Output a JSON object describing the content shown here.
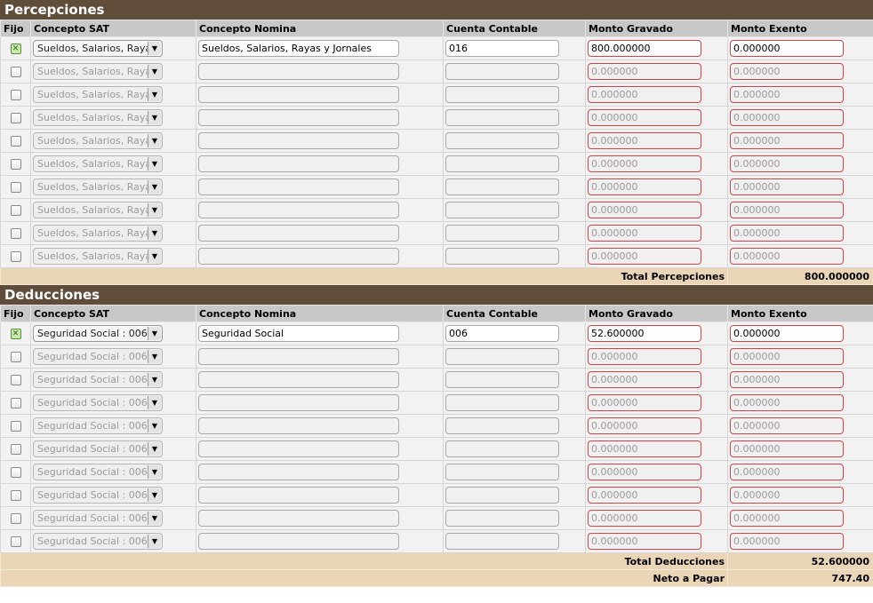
{
  "percepciones": {
    "title": "Percepciones",
    "headers": {
      "fijo": "Fijo",
      "concepto_sat": "Concepto SAT",
      "concepto_nomina": "Concepto Nomina",
      "cuenta_contable": "Cuenta Contable",
      "monto_gravado": "Monto Gravado",
      "monto_exento": "Monto Exento"
    },
    "rows": [
      {
        "fijo": true,
        "concepto_sat": "Sueldos, Salarios, Raya",
        "concepto_nomina": "Sueldos, Salarios, Rayas y Jornales",
        "cuenta": "016",
        "gravado": "800.000000",
        "exento": "0.000000",
        "enabled": true
      },
      {
        "fijo": false,
        "concepto_sat": "Sueldos, Salarios, Raya",
        "concepto_nomina": "",
        "cuenta": "",
        "gravado": "0.000000",
        "exento": "0.000000",
        "enabled": false
      },
      {
        "fijo": false,
        "concepto_sat": "Sueldos, Salarios, Raya",
        "concepto_nomina": "",
        "cuenta": "",
        "gravado": "0.000000",
        "exento": "0.000000",
        "enabled": false
      },
      {
        "fijo": false,
        "concepto_sat": "Sueldos, Salarios, Raya",
        "concepto_nomina": "",
        "cuenta": "",
        "gravado": "0.000000",
        "exento": "0.000000",
        "enabled": false
      },
      {
        "fijo": false,
        "concepto_sat": "Sueldos, Salarios, Raya",
        "concepto_nomina": "",
        "cuenta": "",
        "gravado": "0.000000",
        "exento": "0.000000",
        "enabled": false
      },
      {
        "fijo": false,
        "concepto_sat": "Sueldos, Salarios, Raya",
        "concepto_nomina": "",
        "cuenta": "",
        "gravado": "0.000000",
        "exento": "0.000000",
        "enabled": false
      },
      {
        "fijo": false,
        "concepto_sat": "Sueldos, Salarios, Raya",
        "concepto_nomina": "",
        "cuenta": "",
        "gravado": "0.000000",
        "exento": "0.000000",
        "enabled": false
      },
      {
        "fijo": false,
        "concepto_sat": "Sueldos, Salarios, Raya",
        "concepto_nomina": "",
        "cuenta": "",
        "gravado": "0.000000",
        "exento": "0.000000",
        "enabled": false
      },
      {
        "fijo": false,
        "concepto_sat": "Sueldos, Salarios, Raya",
        "concepto_nomina": "",
        "cuenta": "",
        "gravado": "0.000000",
        "exento": "0.000000",
        "enabled": false
      },
      {
        "fijo": false,
        "concepto_sat": "Sueldos, Salarios, Raya",
        "concepto_nomina": "",
        "cuenta": "",
        "gravado": "0.000000",
        "exento": "0.000000",
        "enabled": false
      }
    ],
    "total_label": "Total Percepciones",
    "total_value": "800.000000"
  },
  "deducciones": {
    "title": "Deducciones",
    "headers": {
      "fijo": "Fijo",
      "concepto_sat": "Concepto SAT",
      "concepto_nomina": "Concepto Nomina",
      "cuenta_contable": "Cuenta Contable",
      "monto_gravado": "Monto Gravado",
      "monto_exento": "Monto Exento"
    },
    "rows": [
      {
        "fijo": true,
        "concepto_sat": "Seguridad Social : 006",
        "concepto_nomina": "Seguridad Social",
        "cuenta": "006",
        "gravado": "52.600000",
        "exento": "0.000000",
        "enabled": true
      },
      {
        "fijo": false,
        "concepto_sat": "Seguridad Social : 006",
        "concepto_nomina": "",
        "cuenta": "",
        "gravado": "0.000000",
        "exento": "0.000000",
        "enabled": false
      },
      {
        "fijo": false,
        "concepto_sat": "Seguridad Social : 006",
        "concepto_nomina": "",
        "cuenta": "",
        "gravado": "0.000000",
        "exento": "0.000000",
        "enabled": false
      },
      {
        "fijo": false,
        "concepto_sat": "Seguridad Social : 006",
        "concepto_nomina": "",
        "cuenta": "",
        "gravado": "0.000000",
        "exento": "0.000000",
        "enabled": false
      },
      {
        "fijo": false,
        "concepto_sat": "Seguridad Social : 006",
        "concepto_nomina": "",
        "cuenta": "",
        "gravado": "0.000000",
        "exento": "0.000000",
        "enabled": false
      },
      {
        "fijo": false,
        "concepto_sat": "Seguridad Social : 006",
        "concepto_nomina": "",
        "cuenta": "",
        "gravado": "0.000000",
        "exento": "0.000000",
        "enabled": false
      },
      {
        "fijo": false,
        "concepto_sat": "Seguridad Social : 006",
        "concepto_nomina": "",
        "cuenta": "",
        "gravado": "0.000000",
        "exento": "0.000000",
        "enabled": false
      },
      {
        "fijo": false,
        "concepto_sat": "Seguridad Social : 006",
        "concepto_nomina": "",
        "cuenta": "",
        "gravado": "0.000000",
        "exento": "0.000000",
        "enabled": false
      },
      {
        "fijo": false,
        "concepto_sat": "Seguridad Social : 006",
        "concepto_nomina": "",
        "cuenta": "",
        "gravado": "0.000000",
        "exento": "0.000000",
        "enabled": false
      },
      {
        "fijo": false,
        "concepto_sat": "Seguridad Social : 006",
        "concepto_nomina": "",
        "cuenta": "",
        "gravado": "0.000000",
        "exento": "0.000000",
        "enabled": false
      }
    ],
    "total_label": "Total Deducciones",
    "total_value": "52.600000"
  },
  "neto": {
    "label": "Neto a Pagar",
    "value": "747.40"
  },
  "icons": {
    "dropdown_arrow": "chevron-down-icon",
    "checked": "check-icon"
  },
  "colors": {
    "section_header": "#5f4c39",
    "column_header": "#c8c8c8",
    "total_row": "#ead6b7",
    "invalid_border": "#d04545"
  }
}
